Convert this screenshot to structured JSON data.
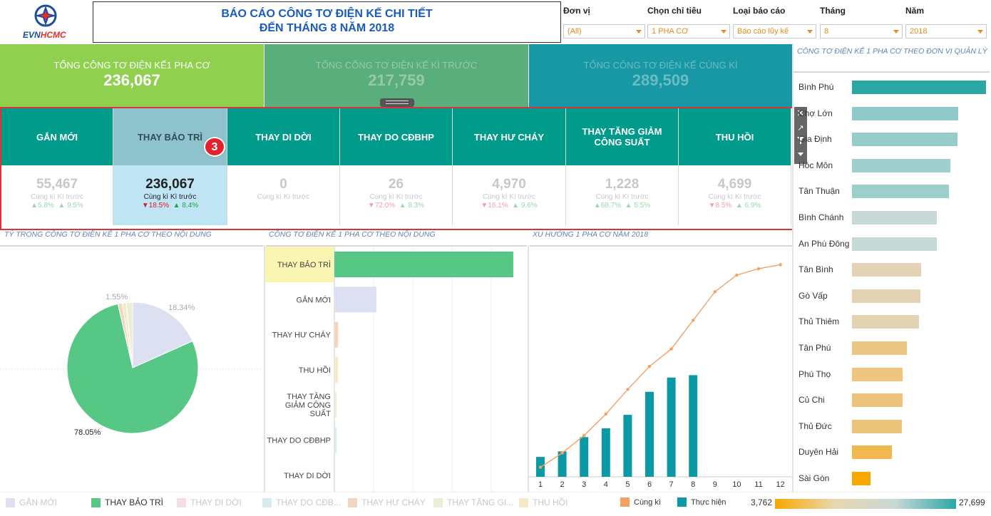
{
  "header": {
    "logo_text": "EVNHCMC",
    "title_line1": "BÁO CÁO CÔNG TƠ ĐIỆN KẾ CHI TIẾT",
    "title_line2": "ĐẾN THÁNG 8 NĂM 2018"
  },
  "filters": [
    {
      "label": "Đơn vị",
      "value": "(All)"
    },
    {
      "label": "Chọn chỉ tiêu",
      "value": "1 PHA CƠ"
    },
    {
      "label": "Loại báo cáo",
      "value": "Báo cáo lũy kế"
    },
    {
      "label": "Tháng",
      "value": "8"
    },
    {
      "label": "Năm",
      "value": "2018"
    }
  ],
  "kpis": [
    {
      "label": "TỔNG CÔNG TƠ ĐIỆN KẾ1 PHA CƠ",
      "value": "236,067",
      "color": "#8fd14f"
    },
    {
      "label": "TỔNG CÔNG TƠ ĐIỆN KẾ KÌ TRƯỚC",
      "value": "217,759",
      "color": "#5aae7c"
    },
    {
      "label": "TỔNG CÔNG TƠ ĐIỆN KẾ CÙNG KÌ",
      "value": "289,509",
      "color": "#1897a5"
    }
  ],
  "categories": [
    {
      "name": "GẮN MỚI",
      "value": "55,467",
      "sub": "Cùng kì  Kì trước",
      "d1": "▲5.8%",
      "d1dir": "up",
      "d2": "▲ 9.5%",
      "d2dir": "up"
    },
    {
      "name": "THAY BẢO TRÌ",
      "value": "236,067",
      "sub": "Cùng kì  Kì trước",
      "d1": "▼18.5%",
      "d1dir": "down",
      "d2": "▲ 8.4%",
      "d2dir": "up"
    },
    {
      "name": "THAY DI DỜI",
      "value": "0",
      "sub": "Cùng kì  Kì trước",
      "d1": "",
      "d1dir": "up",
      "d2": "",
      "d2dir": "up"
    },
    {
      "name": "THAY DO CĐBHP",
      "value": "26",
      "sub": "Cùng kì  Kì trước",
      "d1": "▼72.0%",
      "d1dir": "down",
      "d2": "▲ 8.3%",
      "d2dir": "up"
    },
    {
      "name": "THAY HƯ CHÁY",
      "value": "4,970",
      "sub": "Cùng kì  Kì trước",
      "d1": "▼16.1%",
      "d1dir": "down",
      "d2": "▲ 9.6%",
      "d2dir": "up"
    },
    {
      "name": "THAY TĂNG GIẢM CÔNG SUẤT",
      "value": "1,228",
      "sub": "Cùng kì  Kì trước",
      "d1": "▲68.7%",
      "d1dir": "up",
      "d2": "▲ 5.5%",
      "d2dir": "up"
    },
    {
      "name": "THU HỒI",
      "value": "4,699",
      "sub": "Cùng kì  Kì trước",
      "d1": "▼8.5%",
      "d1dir": "down",
      "d2": "▲ 6.9%",
      "d2dir": "up"
    }
  ],
  "badge": "3",
  "sections": {
    "pie_title": "TỶ TRỌNG CÔNG TƠ ĐIỆN KẾ 1 PHA CƠ THEO NỘI DUNG",
    "bar_title": "CÔNG TƠ ĐIỆN KẾ 1 PHA CƠ THEO NỘI DUNG",
    "trend_title": "XU HƯỚNG 1 PHA CƠ NĂM 2018",
    "right_title": "CÔNG TƠ ĐIỆN KẾ 1 PHA CƠ THEO ĐƠN VỊ QUẢN LÝ"
  },
  "chart_data": [
    {
      "type": "pie",
      "slices": [
        {
          "label": "THAY BẢO TRÌ",
          "value": 78.05,
          "text": "78.05%",
          "color": "#57c785"
        },
        {
          "label": "GẮN MỚI",
          "value": 18.34,
          "text": "18.34%",
          "color": "#dde0f0"
        },
        {
          "label": "THAY TĂNG GIẢM CÔNG SUẤT",
          "value": 1.55,
          "text": "1.55%",
          "color": "#ecedd6"
        },
        {
          "label": "THAY HƯ CHÁY",
          "value": 1.04,
          "text": "",
          "color": "#f2d6c0"
        },
        {
          "label": "THU HỒI",
          "value": 1.02,
          "text": "",
          "color": "#f4eac7"
        }
      ]
    },
    {
      "type": "bar",
      "orientation": "horizontal",
      "categories": [
        "THAY BẢO TRÌ",
        "GẮN MỚI",
        "THAY HƯ CHÁY",
        "THU HỒI",
        "THAY TĂNG GIẢM CÔNG SUẤT",
        "THAY DO CĐBHP",
        "THAY DI DỜI"
      ],
      "values": [
        236067,
        55467,
        4970,
        4699,
        1228,
        26,
        0
      ],
      "colors": [
        "#57c785",
        "#dde0f0",
        "#f2d6c0",
        "#f4eac7",
        "#ecedd6",
        "#d7ecee",
        "#f4dde3"
      ],
      "highlight": "THAY BẢO TRÌ",
      "xlim": [
        0,
        250000
      ]
    },
    {
      "type": "bar+line",
      "x": [
        "1",
        "2",
        "3",
        "4",
        "5",
        "6",
        "7",
        "8",
        "9",
        "10",
        "11",
        "12"
      ],
      "series": [
        {
          "name": "Thực hiện",
          "type": "bar",
          "color": "#0b9aa5",
          "values": [
            25000,
            32000,
            50000,
            61000,
            78000,
            107000,
            125000,
            128000,
            null,
            null,
            null,
            null
          ]
        },
        {
          "name": "Cùng kì",
          "type": "line",
          "color": "#f5a162",
          "values": [
            12000,
            30000,
            52000,
            79000,
            110000,
            139000,
            161000,
            197000,
            233000,
            254000,
            262000,
            267000
          ]
        }
      ],
      "ylim": [
        0,
        280000
      ]
    },
    {
      "type": "bar",
      "orientation": "horizontal",
      "categories": [
        "Bình Phú",
        "Chợ Lớn",
        "Gia Định",
        "Hóc Môn",
        "Tân Thuận",
        "Bình Chánh",
        "An Phú Đông",
        "Tân Bình",
        "Gò Vấp",
        "Thủ Thiêm",
        "Tân Phú",
        "Phú Thọ",
        "Củ Chi",
        "Thủ Đức",
        "Duyên Hải",
        "Sài Gòn"
      ],
      "values": [
        27699,
        22000,
        21800,
        20300,
        20000,
        17500,
        17500,
        14300,
        14200,
        13800,
        11300,
        10500,
        10400,
        10300,
        8300,
        3762
      ],
      "colors": [
        "#2ca7a4",
        "#8ecbc8",
        "#96cdca",
        "#9ecfcc",
        "#9ccecb",
        "#c7d9d7",
        "#c7d9d7",
        "#e3d3b4",
        "#e3d3b4",
        "#e4d3b2",
        "#ecc684",
        "#edc57c",
        "#ecc37a",
        "#ecc37a",
        "#f1b750",
        "#f8a800"
      ],
      "xlim": [
        0,
        28000
      ]
    }
  ],
  "legend": {
    "items": [
      {
        "label": "GẮN MỚI",
        "color": "#dde0f0",
        "dim": true
      },
      {
        "label": "THAY BẢO TRÌ",
        "color": "#57c785",
        "dim": false
      },
      {
        "label": "THAY DI DỜI",
        "color": "#f4dde3",
        "dim": true
      },
      {
        "label": "THAY DO CĐB...",
        "color": "#d7ecee",
        "dim": true
      },
      {
        "label": "THAY HƯ CHÁY",
        "color": "#f2d6c0",
        "dim": true
      },
      {
        "label": "THAY TĂNG GI...",
        "color": "#ecedd6",
        "dim": true
      },
      {
        "label": "THU HỒI",
        "color": "#f4eac7",
        "dim": true
      }
    ],
    "trend_items": [
      {
        "label": "Cùng kì",
        "color": "#f5a162"
      },
      {
        "label": "Thực hiện",
        "color": "#0b9aa5"
      }
    ],
    "scale_min": "3,762",
    "scale_max": "27,699"
  }
}
